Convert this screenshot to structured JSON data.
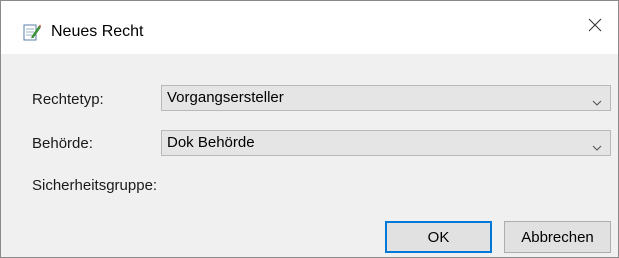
{
  "dialog": {
    "title": "Neues Recht",
    "icon": "edit-document-icon",
    "close_icon": "close-icon"
  },
  "fields": {
    "rechtetyp": {
      "label": "Rechtetyp:",
      "value": "Vorgangsersteller"
    },
    "behoerde": {
      "label": "Behörde:",
      "value": "Dok Behörde"
    },
    "sicherheitsgruppe": {
      "label": "Sicherheitsgruppe:"
    }
  },
  "buttons": {
    "ok": "OK",
    "cancel": "Abbrechen"
  },
  "colors": {
    "accent": "#0078d7",
    "dialog_bg": "#f0f0f0",
    "select_bg": "#e5e5e5"
  }
}
